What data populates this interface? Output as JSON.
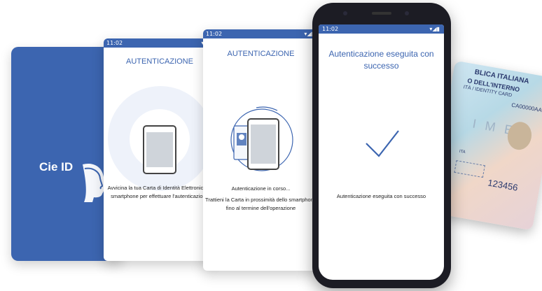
{
  "brand": {
    "logo_text": "Cie ID",
    "primary_color": "#3c65b0"
  },
  "screen1": {
    "time": "11:02",
    "title": "AUTENTICAZIONE",
    "instruction_line1": "Avvicina la tua Carta di Identità Elettronica al",
    "instruction_line2": "smartphone per effettuare l'autenticazione"
  },
  "screen2": {
    "time": "11:02",
    "title": "AUTENTICAZIONE",
    "status": "Autenticazione in corso...",
    "hint_line1": "Trattieni la Carta in prossimità dello smartphone",
    "hint_line2": "fino al termine dell'operazione"
  },
  "phone": {
    "time": "11:02",
    "title_line1": "Autenticazione eseguita con",
    "title_line2": "successo",
    "message": "Autenticazione eseguita con successo",
    "check_color": "#3c65b0"
  },
  "id_card": {
    "header1": "BLICA ITALIANA",
    "header2": "O DELL'INTERNO",
    "header3": "ITÀ / IDENTITY CARD",
    "number": "CA00000AA",
    "watermark": "I M E N",
    "nationality": "ITA",
    "pan": "123456"
  }
}
